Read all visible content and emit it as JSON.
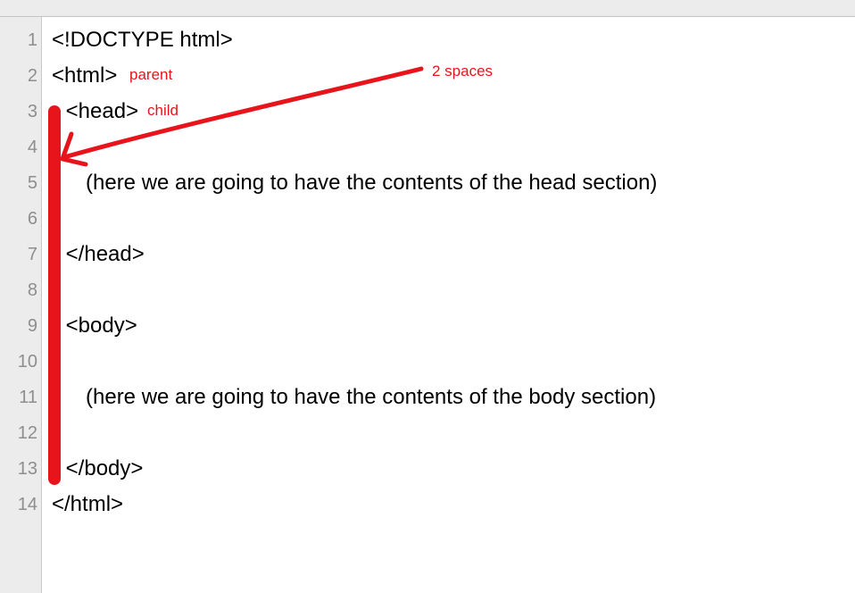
{
  "line_numbers": [
    "1",
    "2",
    "3",
    "4",
    "5",
    "6",
    "7",
    "8",
    "9",
    "10",
    "11",
    "12",
    "13",
    "14"
  ],
  "code_lines": [
    "<!DOCTYPE html>",
    "<html>",
    " <head>",
    "",
    "   (here we are going to have the contents of the head section)",
    "",
    " </head>",
    "",
    " <body>",
    "",
    "   (here we are going to have the contents of the body section)",
    "",
    " </body>",
    "</html>"
  ],
  "annotations": {
    "parent_label": "parent",
    "child_label": "child",
    "spaces_label": "2 spaces",
    "color": "#e8141c"
  }
}
